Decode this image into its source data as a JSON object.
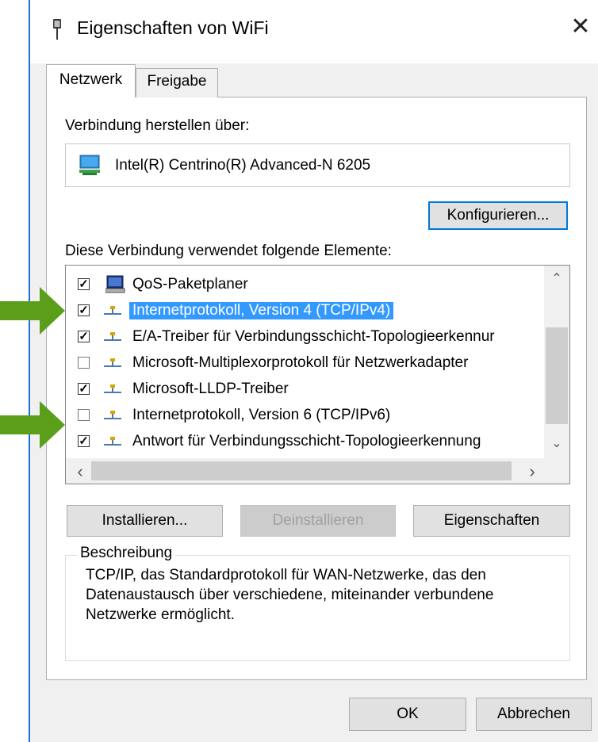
{
  "window": {
    "title": "Eigenschaften von WiFi",
    "close_glyph": "✕"
  },
  "tabs": [
    {
      "label": "Netzwerk",
      "active": true
    },
    {
      "label": "Freigabe",
      "active": false
    }
  ],
  "connection": {
    "label": "Verbindung herstellen über:",
    "adapter": "Intel(R) Centrino(R) Advanced-N 6205",
    "adapter_icon": "network-adapter-icon"
  },
  "buttons": {
    "configure": "Konfigurieren...",
    "install": "Installieren...",
    "uninstall": "Deinstallieren",
    "properties": "Eigenschaften",
    "ok": "OK",
    "cancel": "Abbrechen"
  },
  "elements": {
    "label": "Diese Verbindung verwendet folgende Elemente:",
    "items": [
      {
        "label": "QoS-Paketplaner",
        "checked": true,
        "icon": "qos-scheduler-icon",
        "selected": false
      },
      {
        "label": "Internetprotokoll, Version 4 (TCP/IPv4)",
        "checked": true,
        "icon": "protocol-icon",
        "selected": true
      },
      {
        "label": "E/A-Treiber für Verbindungsschicht-Topologieerkennur",
        "checked": true,
        "icon": "protocol-icon",
        "selected": false
      },
      {
        "label": "Microsoft-Multiplexorprotokoll für Netzwerkadapter",
        "checked": false,
        "icon": "protocol-icon",
        "selected": false
      },
      {
        "label": "Microsoft-LLDP-Treiber",
        "checked": true,
        "icon": "protocol-icon",
        "selected": false
      },
      {
        "label": "Internetprotokoll, Version 6 (TCP/IPv6)",
        "checked": false,
        "icon": "protocol-icon",
        "selected": false
      },
      {
        "label": "Antwort für Verbindungsschicht-Topologieerkennung",
        "checked": true,
        "icon": "protocol-icon",
        "selected": false
      }
    ]
  },
  "scroll_glyphs": {
    "up": "⌃",
    "down": "⌄",
    "left": "‹",
    "right": "›"
  },
  "description": {
    "legend": "Beschreibung",
    "text": "TCP/IP, das Standardprotokoll für WAN-Netzwerke, das den Datenaustausch über verschiedene, miteinander verbundene Netzwerke ermöglicht."
  },
  "colors": {
    "selection": "#3399ff",
    "accent": "#0078d7",
    "arrow": "#5a9e1a"
  }
}
